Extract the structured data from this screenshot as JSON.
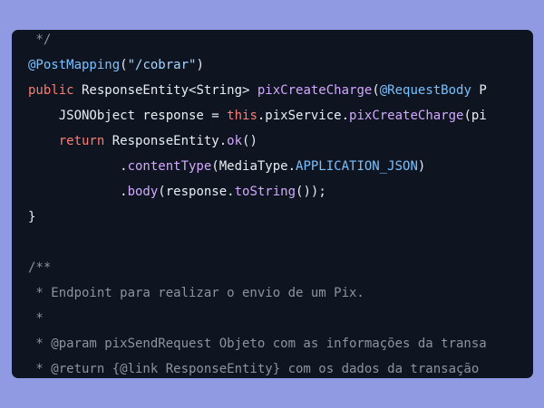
{
  "code_lines": [
    [
      {
        "t": " */",
        "k": "comment"
      }
    ],
    [
      {
        "t": "@PostMapping",
        "k": "annotation"
      },
      {
        "t": "(",
        "k": "default"
      },
      {
        "t": "\"/cobrar\"",
        "k": "string"
      },
      {
        "t": ")",
        "k": "default"
      }
    ],
    [
      {
        "t": "public",
        "k": "keyword"
      },
      {
        "t": " ResponseEntity<String> ",
        "k": "default"
      },
      {
        "t": "pixCreateCharge",
        "k": "function"
      },
      {
        "t": "(",
        "k": "default"
      },
      {
        "t": "@RequestBody",
        "k": "annotation"
      },
      {
        "t": " P",
        "k": "default"
      }
    ],
    [
      {
        "t": "    JSONObject response = ",
        "k": "default"
      },
      {
        "t": "this",
        "k": "keyword"
      },
      {
        "t": ".pixService.",
        "k": "default"
      },
      {
        "t": "pixCreateCharge",
        "k": "function"
      },
      {
        "t": "(pi",
        "k": "default"
      }
    ],
    [
      {
        "t": "    ",
        "k": "default"
      },
      {
        "t": "return",
        "k": "keyword"
      },
      {
        "t": " ResponseEntity.",
        "k": "default"
      },
      {
        "t": "ok",
        "k": "function"
      },
      {
        "t": "()",
        "k": "default"
      }
    ],
    [
      {
        "t": "            .",
        "k": "default"
      },
      {
        "t": "contentType",
        "k": "function"
      },
      {
        "t": "(MediaType.",
        "k": "default"
      },
      {
        "t": "APPLICATION_JSON",
        "k": "constant"
      },
      {
        "t": ")",
        "k": "default"
      }
    ],
    [
      {
        "t": "            .",
        "k": "default"
      },
      {
        "t": "body",
        "k": "function"
      },
      {
        "t": "(response.",
        "k": "default"
      },
      {
        "t": "toString",
        "k": "function"
      },
      {
        "t": "());",
        "k": "default"
      }
    ],
    [
      {
        "t": "}",
        "k": "default"
      }
    ],
    [
      {
        "t": "",
        "k": "default"
      }
    ],
    [
      {
        "t": "/**",
        "k": "comment"
      }
    ],
    [
      {
        "t": " * Endpoint para realizar o envio de um Pix.",
        "k": "comment"
      }
    ],
    [
      {
        "t": " *",
        "k": "comment"
      }
    ],
    [
      {
        "t": " * @param pixSendRequest Objeto com as informações da transa",
        "k": "comment"
      }
    ],
    [
      {
        "t": " * @return {@link ResponseEntity} com os dados da transação",
        "k": "comment"
      }
    ]
  ]
}
